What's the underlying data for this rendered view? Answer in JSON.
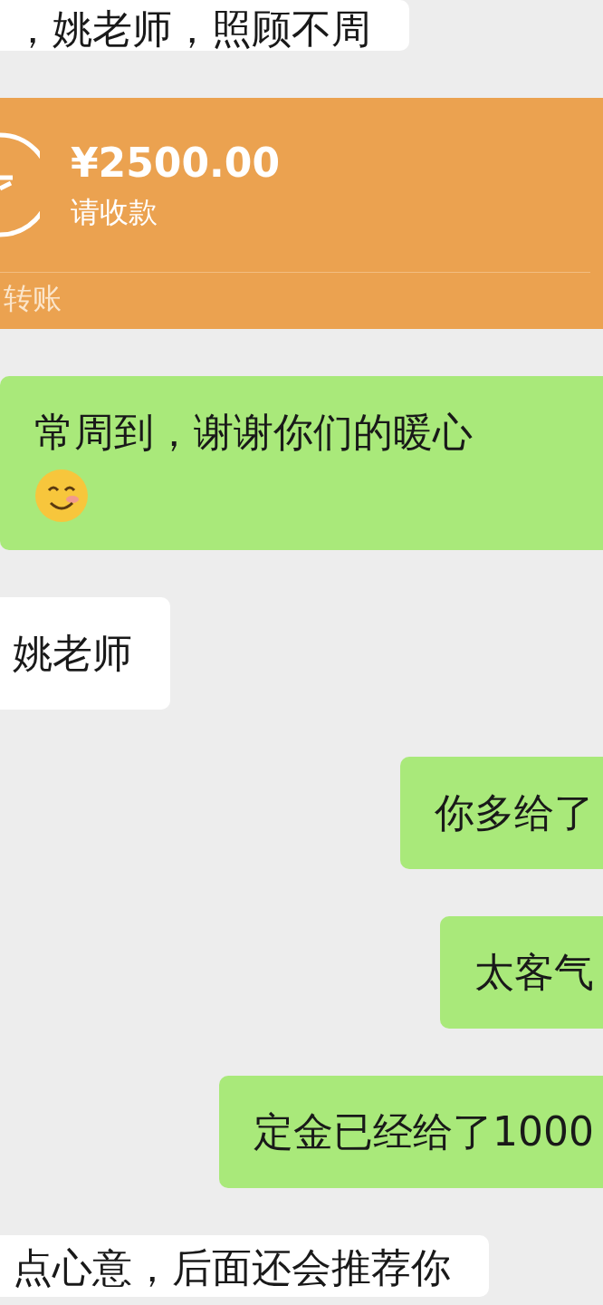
{
  "messages": [
    {
      "kind": "incoming",
      "text": "，姚老师，照顾不周"
    },
    {
      "kind": "transfer",
      "amount": "¥2500.00",
      "note": "请收款",
      "footer": "转账"
    },
    {
      "kind": "outgoing",
      "text": "常周到，谢谢你们的暖心",
      "emoji": true
    },
    {
      "kind": "incoming",
      "text": "姚老师"
    },
    {
      "kind": "outgoing",
      "text": "你多给了"
    },
    {
      "kind": "outgoing",
      "text": "太客气"
    },
    {
      "kind": "outgoing",
      "text": "定金已经给了1000"
    },
    {
      "kind": "incoming",
      "text": "点心意，后面还会推荐你"
    }
  ]
}
